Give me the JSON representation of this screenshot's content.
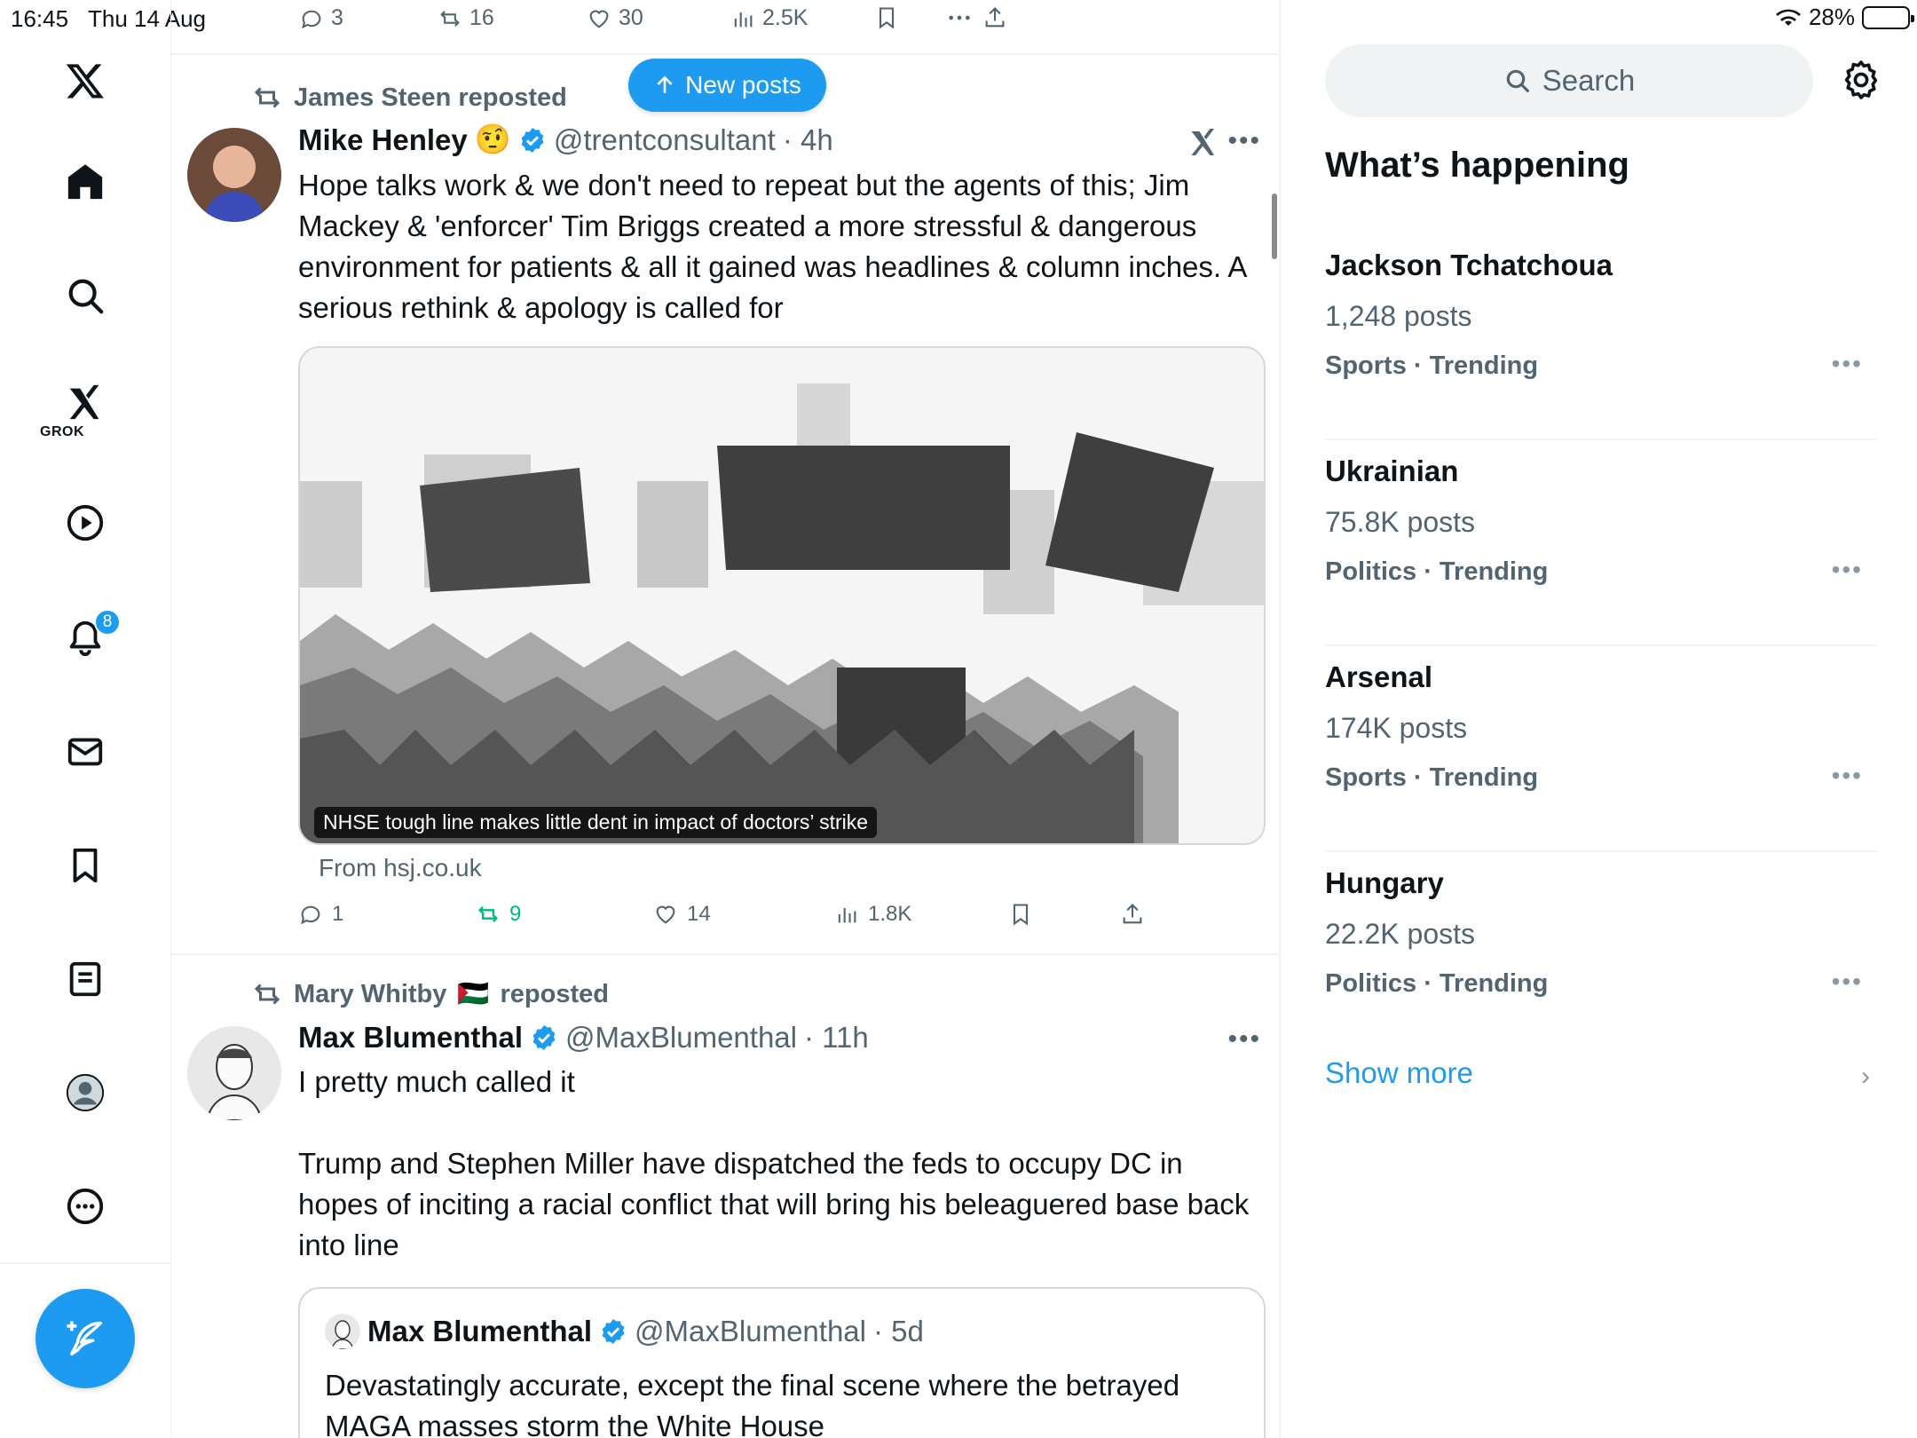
{
  "status_bar": {
    "time": "16:45",
    "date": "Thu 14 Aug",
    "battery": "28%",
    "battery_level": 0.28
  },
  "nav": {
    "grok_label": "GROK",
    "notifications_badge": "8"
  },
  "top_actions": {
    "replies": "3",
    "reposts": "16",
    "likes": "30",
    "views": "2.5K"
  },
  "new_posts_label": "New posts",
  "post1": {
    "repost_by": "James Steen reposted",
    "name": "Mike Henley",
    "emoji": "🤨",
    "handle": "@trentconsultant",
    "time": "· 4h",
    "text": "Hope talks work & we don't need to repeat but the agents of this; Jim Mackey & 'enforcer' Tim Briggs created a more stressful & dangerous environment for patients & all it gained was headlines & column inches. A serious rethink & apology is called for",
    "card_caption": "NHSE tough line makes little dent in impact of doctors’ strike",
    "card_from": "From hsj.co.uk",
    "replies": "1",
    "reposts": "9",
    "likes": "14",
    "views": "1.8K"
  },
  "post2": {
    "repost_by": "Mary Whitby",
    "repost_flag": "🇵🇸",
    "repost_suffix": "reposted",
    "name": "Max Blumenthal",
    "handle": "@MaxBlumenthal",
    "time": "· 11h",
    "text": "I pretty much called it\n\nTrump and Stephen Miller have dispatched the feds to occupy DC in hopes of inciting a racial conflict that will bring his beleaguered base back into line",
    "quote": {
      "name": "Max Blumenthal",
      "handle": "@MaxBlumenthal",
      "time": "· 5d",
      "text": "Devastatingly accurate, except the final scene where the betrayed MAGA masses storm the White House"
    }
  },
  "sidebar": {
    "search_placeholder": "Search",
    "heading": "What’s happening",
    "trends": [
      {
        "name": "Jackson Tchatchoua",
        "count": "1,248 posts",
        "category": "Sports · Trending"
      },
      {
        "name": "Ukrainian",
        "count": "75.8K posts",
        "category": "Politics · Trending"
      },
      {
        "name": "Arsenal",
        "count": "174K posts",
        "category": "Sports · Trending"
      },
      {
        "name": "Hungary",
        "count": "22.2K posts",
        "category": "Politics · Trending"
      }
    ],
    "show_more": "Show more"
  },
  "colors": {
    "accent": "#1d9bf0",
    "muted": "#536471",
    "repost_green": "#00ba7c"
  }
}
